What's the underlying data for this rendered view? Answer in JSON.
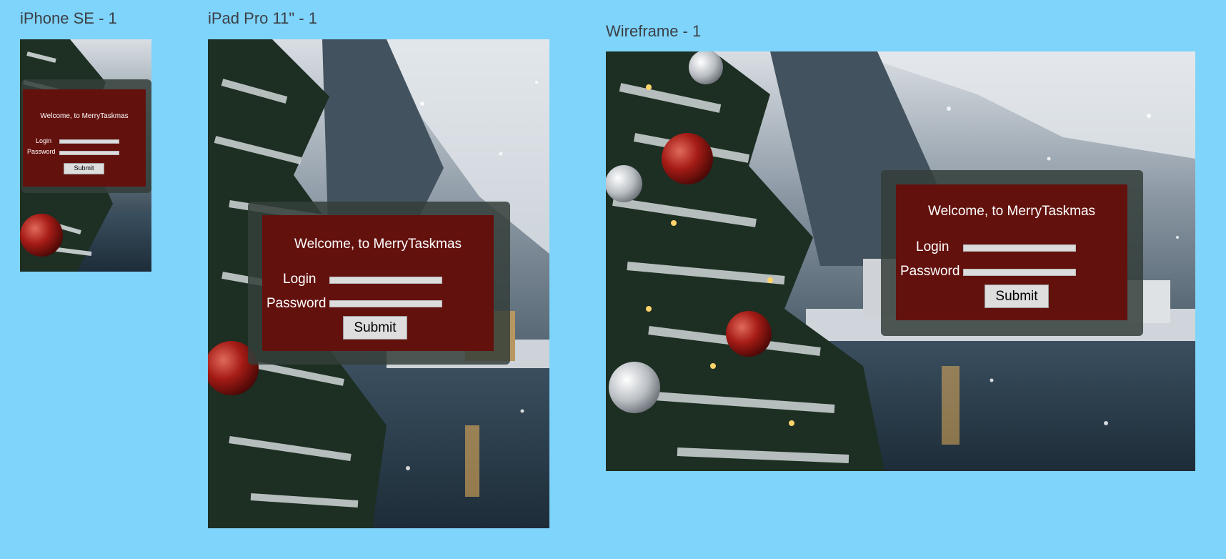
{
  "frames": [
    {
      "id": "iphone",
      "title": "iPhone SE - 1",
      "form": {
        "welcome": "Welcome, to MerryTaskmas",
        "login_label": "Login",
        "password_label": "Password",
        "submit_label": "Submit"
      }
    },
    {
      "id": "ipad",
      "title": "iPad Pro 11\" - 1",
      "form": {
        "welcome": "Welcome, to MerryTaskmas",
        "login_label": "Login",
        "password_label": "Password",
        "submit_label": "Submit"
      }
    },
    {
      "id": "wireframe",
      "title": "Wireframe - 1",
      "form": {
        "welcome": "Welcome, to MerryTaskmas",
        "login_label": "Login",
        "password_label": "Password",
        "submit_label": "Submit"
      }
    }
  ],
  "colors": {
    "canvas": "#7fd4fb",
    "panel": "#63110d",
    "overlay": "#343e3a",
    "field": "#dcdcdc"
  }
}
